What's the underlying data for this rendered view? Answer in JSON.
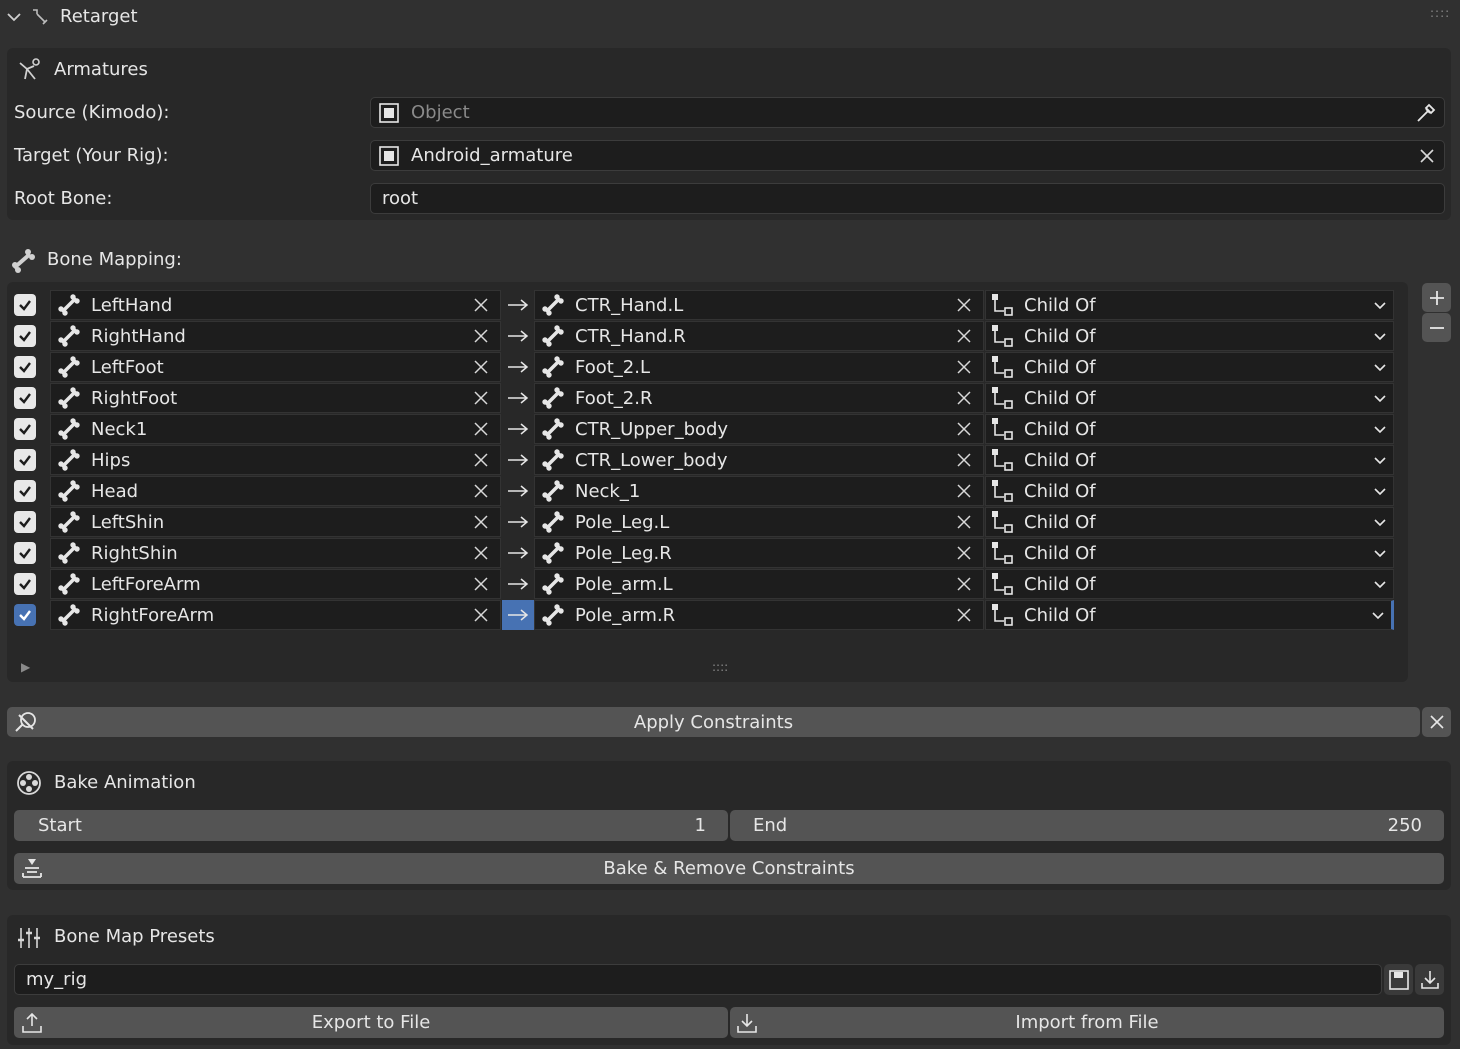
{
  "header": {
    "title": "Retarget",
    "icon": "bone-wrench-icon"
  },
  "armatures": {
    "title": "Armatures",
    "source_label": "Source (Kimodo):",
    "source_placeholder": "Object",
    "target_label": "Target (Your Rig):",
    "target_value": "Android_armature",
    "root_label": "Root Bone:",
    "root_value": "root"
  },
  "bone_mapping": {
    "title": "Bone Mapping:",
    "constraint_default": "Child Of",
    "rows": [
      {
        "source": "LeftHand",
        "target": "CTR_Hand.L",
        "constraint": "Child Of",
        "checked": true
      },
      {
        "source": "RightHand",
        "target": "CTR_Hand.R",
        "constraint": "Child Of",
        "checked": true
      },
      {
        "source": "LeftFoot",
        "target": "Foot_2.L",
        "constraint": "Child Of",
        "checked": true
      },
      {
        "source": "RightFoot",
        "target": "Foot_2.R",
        "constraint": "Child Of",
        "checked": true
      },
      {
        "source": "Neck1",
        "target": "CTR_Upper_body",
        "constraint": "Child Of",
        "checked": true
      },
      {
        "source": "Hips",
        "target": "CTR_Lower_body",
        "constraint": "Child Of",
        "checked": true
      },
      {
        "source": "Head",
        "target": "Neck_1",
        "constraint": "Child Of",
        "checked": true
      },
      {
        "source": "LeftShin",
        "target": "Pole_Leg.L",
        "constraint": "Child Of",
        "checked": true
      },
      {
        "source": "RightShin",
        "target": "Pole_Leg.R",
        "constraint": "Child Of",
        "checked": true
      },
      {
        "source": "LeftForeArm",
        "target": "Pole_arm.L",
        "constraint": "Child Of",
        "checked": true
      },
      {
        "source": "RightForeArm",
        "target": "Pole_arm.R",
        "constraint": "Child Of",
        "checked": true,
        "selected": true
      }
    ]
  },
  "apply": {
    "label": "Apply Constraints"
  },
  "bake": {
    "title": "Bake Animation",
    "start_label": "Start",
    "start_value": "1",
    "end_label": "End",
    "end_value": "250",
    "bake_button": "Bake & Remove Constraints"
  },
  "presets": {
    "title": "Bone Map Presets",
    "value": "my_rig",
    "export_label": "Export to File",
    "import_label": "Import from File"
  },
  "colors": {
    "background": "#303030",
    "panel": "#282828",
    "field": "#1d1d1d",
    "button": "#545454",
    "accent": "#4772b3"
  }
}
